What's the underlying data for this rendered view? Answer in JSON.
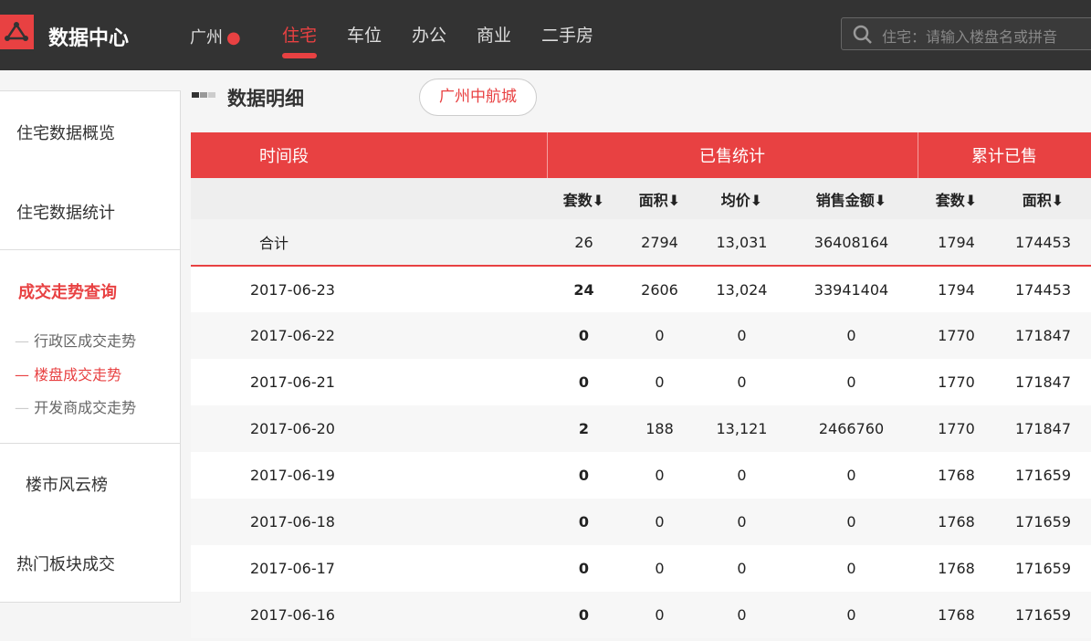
{
  "header": {
    "brand": "数据中心",
    "city": "广州",
    "nav": [
      "住宅",
      "车位",
      "办公",
      "商业",
      "二手房"
    ],
    "search_placeholder": "住宅：请输入楼盘名或拼音"
  },
  "sidebar": {
    "items": [
      "住宅数据概览",
      "住宅数据统计",
      "成交走势查询",
      "楼市风云榜",
      "热门板块成交"
    ],
    "sub": [
      "行政区成交走势",
      "楼盘成交走势",
      "开发商成交走势"
    ]
  },
  "main": {
    "title": "数据明细",
    "project": "广州中航城"
  },
  "table": {
    "groups": [
      "时间段",
      "已售统计",
      "累计已售"
    ],
    "sub": [
      "套数⬇",
      "面积⬇",
      "均价⬇",
      "销售金额⬇",
      "套数⬇",
      "面积⬇"
    ],
    "total": [
      "合计",
      "26",
      "2794",
      "13,031",
      "36408164",
      "1794",
      "174453"
    ],
    "rows": [
      [
        "2017-06-23",
        "24",
        "2606",
        "13,024",
        "33941404",
        "1794",
        "174453"
      ],
      [
        "2017-06-22",
        "0",
        "0",
        "0",
        "0",
        "1770",
        "171847"
      ],
      [
        "2017-06-21",
        "0",
        "0",
        "0",
        "0",
        "1770",
        "171847"
      ],
      [
        "2017-06-20",
        "2",
        "188",
        "13,121",
        "2466760",
        "1770",
        "171847"
      ],
      [
        "2017-06-19",
        "0",
        "0",
        "0",
        "0",
        "1768",
        "171659"
      ],
      [
        "2017-06-18",
        "0",
        "0",
        "0",
        "0",
        "1768",
        "171659"
      ],
      [
        "2017-06-17",
        "0",
        "0",
        "0",
        "0",
        "1768",
        "171659"
      ],
      [
        "2017-06-16",
        "0",
        "0",
        "0",
        "0",
        "1768",
        "171659"
      ]
    ]
  },
  "colors": {
    "accent": "#e84142",
    "topbar": "#333333"
  }
}
